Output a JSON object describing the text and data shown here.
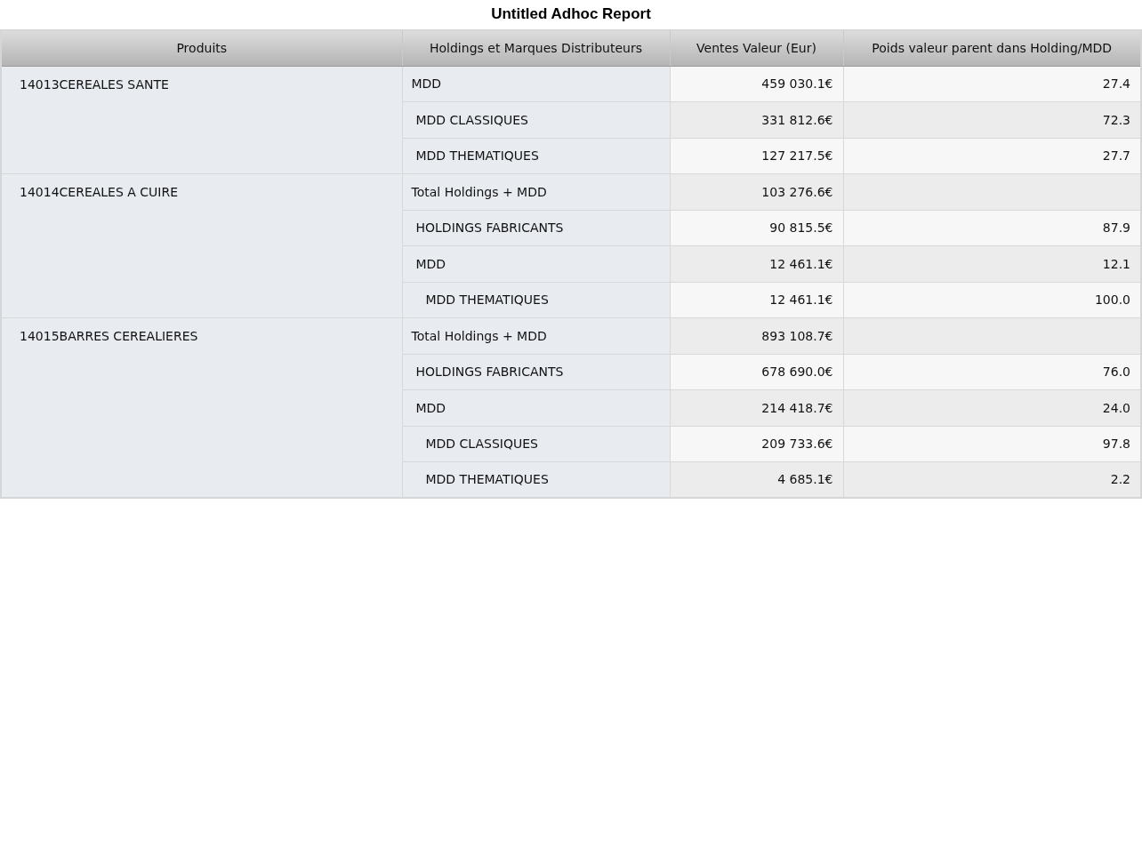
{
  "title": "Untitled Adhoc Report",
  "columns": [
    "Produits",
    "Holdings et Marques Distributeurs",
    "Ventes Valeur (Eur)",
    "Poids valeur parent dans Holding/MDD"
  ],
  "products": [
    {
      "name": "14013CEREALES SANTE",
      "rows": [
        {
          "label": "MDD",
          "sales": "459 030.1€",
          "weight": "27.4",
          "children": [
            {
              "label": "MDD CLASSIQUES",
              "sales": "331 812.6€",
              "weight": "72.3"
            },
            {
              "label": "MDD THEMATIQUES",
              "sales": "127 217.5€",
              "weight": "27.7"
            }
          ]
        }
      ]
    },
    {
      "name": "14014CEREALES A CUIRE",
      "rows": [
        {
          "label": "Total Holdings + MDD",
          "sales": "103 276.6€",
          "children": [
            {
              "label": "HOLDINGS FABRICANTS",
              "sales": "90 815.5€",
              "weight": "87.9"
            },
            {
              "label": "MDD",
              "sales": "12 461.1€",
              "weight": "12.1",
              "children": [
                {
                  "label": "MDD THEMATIQUES",
                  "sales": "12 461.1€",
                  "weight": "100.0"
                }
              ]
            }
          ]
        }
      ]
    },
    {
      "name": "14015BARRES CEREALIERES",
      "rows": [
        {
          "label": "Total Holdings + MDD",
          "sales": "893 108.7€",
          "children": [
            {
              "label": "HOLDINGS FABRICANTS",
              "sales": "678 690.0€",
              "weight": "76.0"
            },
            {
              "label": "MDD",
              "sales": "214 418.7€",
              "weight": "24.0",
              "children": [
                {
                  "label": "MDD CLASSIQUES",
                  "sales": "209 733.6€",
                  "weight": "97.8"
                },
                {
                  "label": "MDD THEMATIQUES",
                  "sales": "4 685.1€",
                  "weight": "2.2"
                }
              ]
            }
          ]
        }
      ]
    }
  ]
}
